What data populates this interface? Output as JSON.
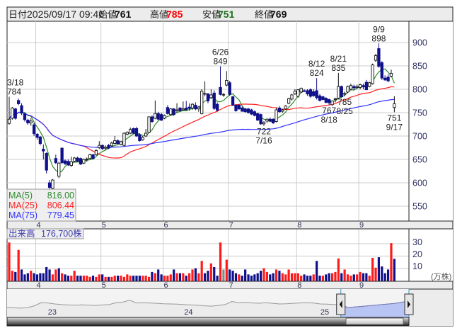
{
  "header": {
    "date_label": "日付",
    "datetime": "2025/09/17 09:46",
    "open_label": "始値",
    "open": "761",
    "high_label": "高値",
    "high": "785",
    "low_label": "安値",
    "low": "751",
    "close_label": "終値",
    "close": "769",
    "colors": {
      "high": "#ff0000",
      "low": "#1e6e1e",
      "open": "#111111",
      "close": "#111111"
    }
  },
  "legend": {
    "ma5_label": "MA(5)",
    "ma5_value": "816.00",
    "ma25_label": "MA(25)",
    "ma25_value": "806.44",
    "ma75_label": "MA(75)",
    "ma75_value": "779.45"
  },
  "volume_legend": {
    "label": "出来高",
    "value": "176,700株"
  },
  "volume_axis": {
    "ticks": [
      "30",
      "20",
      "10"
    ],
    "unit": "(万株)"
  },
  "colors": {
    "up_candle": "#ffffff",
    "down_candle": "#10108a",
    "ma5": "#2e8b2e",
    "ma25": "#ff2020",
    "ma75": "#3030ff",
    "vol_up": "#ff1a1a",
    "vol_down": "#10108a",
    "vol_flat": "#888888",
    "navigator_selected": "#b8c4f4"
  },
  "chart_data": {
    "type": "candlestick",
    "price_axis": {
      "ticks": [
        900,
        850,
        800,
        750,
        700,
        650,
        600,
        550
      ],
      "range": [
        525,
        935
      ]
    },
    "volume_range": [
      0,
      31
    ],
    "grid": true,
    "months": [
      {
        "label": "4",
        "start_index": 9
      },
      {
        "label": "5",
        "start_index": 30
      },
      {
        "label": "6",
        "start_index": 50
      },
      {
        "label": "7",
        "start_index": 71
      },
      {
        "label": "8",
        "start_index": 93
      },
      {
        "label": "9",
        "start_index": 113
      }
    ],
    "ohlc": [
      [
        727,
        784,
        724,
        736
      ],
      [
        738,
        762,
        735,
        760
      ],
      [
        758,
        760,
        735,
        738
      ],
      [
        776,
        780,
        766,
        769
      ],
      [
        765,
        770,
        745,
        749
      ],
      [
        747,
        750,
        731,
        735
      ],
      [
        734,
        737,
        724,
        728
      ],
      [
        728,
        738,
        722,
        732
      ],
      [
        724,
        728,
        700,
        705
      ],
      [
        704,
        706,
        692,
        697
      ],
      [
        698,
        700,
        680,
        684
      ],
      [
        672,
        682,
        650,
        668
      ],
      [
        663,
        665,
        620,
        627
      ],
      [
        600,
        606,
        582,
        590
      ],
      [
        588,
        608,
        585,
        606
      ],
      [
        652,
        660,
        640,
        643
      ],
      [
        614,
        645,
        610,
        642
      ],
      [
        674,
        676,
        640,
        643
      ],
      [
        647,
        650,
        638,
        641
      ],
      [
        646,
        650,
        636,
        638
      ],
      [
        637,
        656,
        634,
        645
      ],
      [
        646,
        655,
        644,
        653
      ],
      [
        653,
        656,
        644,
        646
      ],
      [
        652,
        654,
        638,
        640
      ],
      [
        642,
        652,
        640,
        650
      ],
      [
        650,
        654,
        645,
        651
      ],
      [
        652,
        662,
        650,
        660
      ],
      [
        660,
        662,
        650,
        652
      ],
      [
        660,
        672,
        658,
        669
      ],
      [
        675,
        689,
        672,
        680
      ],
      [
        680,
        682,
        670,
        673
      ],
      [
        674,
        680,
        670,
        676
      ],
      [
        680,
        683,
        672,
        674
      ],
      [
        679,
        688,
        676,
        685
      ],
      [
        684,
        700,
        682,
        690
      ],
      [
        690,
        693,
        682,
        684
      ],
      [
        682,
        690,
        680,
        688
      ],
      [
        680,
        708,
        678,
        706
      ],
      [
        704,
        710,
        702,
        708
      ],
      [
        706,
        718,
        704,
        714
      ],
      [
        716,
        718,
        704,
        706
      ],
      [
        716,
        720,
        698,
        700
      ],
      [
        703,
        706,
        688,
        690
      ],
      [
        692,
        700,
        690,
        697
      ],
      [
        700,
        715,
        698,
        706
      ],
      [
        708,
        742,
        706,
        741
      ],
      [
        741,
        744,
        728,
        731
      ],
      [
        738,
        776,
        736,
        748
      ],
      [
        748,
        752,
        734,
        736
      ],
      [
        746,
        750,
        732,
        734
      ],
      [
        738,
        746,
        736,
        744
      ],
      [
        761,
        766,
        746,
        748
      ],
      [
        746,
        760,
        744,
        758
      ],
      [
        758,
        760,
        743,
        746
      ],
      [
        754,
        770,
        750,
        756
      ],
      [
        760,
        762,
        752,
        754
      ],
      [
        756,
        774,
        754,
        758
      ],
      [
        760,
        775,
        755,
        756
      ],
      [
        762,
        770,
        754,
        759
      ],
      [
        760,
        770,
        756,
        768
      ],
      [
        766,
        772,
        755,
        758
      ],
      [
        758,
        764,
        752,
        762
      ],
      [
        748,
        800,
        746,
        796
      ],
      [
        790,
        817,
        785,
        791
      ],
      [
        790,
        792,
        770,
        775
      ],
      [
        782,
        800,
        780,
        788
      ],
      [
        792,
        798,
        756,
        759
      ],
      [
        768,
        772,
        752,
        755
      ],
      [
        804,
        849,
        787,
        789
      ],
      [
        788,
        792,
        784,
        789
      ],
      [
        809,
        839,
        806,
        819
      ],
      [
        814,
        818,
        786,
        789
      ],
      [
        784,
        786,
        764,
        766
      ],
      [
        766,
        768,
        752,
        754
      ],
      [
        766,
        768,
        756,
        758
      ],
      [
        760,
        763,
        752,
        753
      ],
      [
        758,
        760,
        750,
        752
      ],
      [
        758,
        760,
        748,
        750
      ],
      [
        756,
        758,
        745,
        747
      ],
      [
        752,
        755,
        742,
        744
      ],
      [
        748,
        750,
        732,
        734
      ],
      [
        746,
        748,
        724,
        726
      ],
      [
        726,
        732,
        722,
        729
      ],
      [
        732,
        738,
        728,
        736
      ],
      [
        736,
        740,
        730,
        732
      ],
      [
        736,
        738,
        726,
        728
      ],
      [
        731,
        760,
        729,
        756
      ],
      [
        760,
        764,
        750,
        752
      ],
      [
        753,
        758,
        750,
        756
      ],
      [
        758,
        766,
        756,
        764
      ],
      [
        770,
        782,
        768,
        780
      ],
      [
        779,
        790,
        776,
        788
      ],
      [
        790,
        800,
        788,
        796
      ],
      [
        785,
        800,
        782,
        799
      ],
      [
        794,
        804,
        792,
        802
      ],
      [
        797,
        800,
        794,
        796
      ],
      [
        797,
        800,
        786,
        790
      ],
      [
        799,
        802,
        782,
        785
      ],
      [
        795,
        800,
        784,
        786
      ],
      [
        797,
        824,
        778,
        782
      ],
      [
        786,
        790,
        774,
        776
      ],
      [
        784,
        786,
        776,
        778
      ],
      [
        781,
        783,
        770,
        772
      ],
      [
        778,
        780,
        767,
        771
      ],
      [
        767,
        776,
        765,
        775
      ],
      [
        778,
        782,
        772,
        780
      ],
      [
        781,
        835,
        779,
        806
      ],
      [
        806,
        808,
        782,
        784
      ],
      [
        790,
        795,
        785,
        791
      ],
      [
        794,
        808,
        792,
        806
      ],
      [
        800,
        812,
        798,
        808
      ],
      [
        806,
        810,
        798,
        803
      ],
      [
        804,
        810,
        800,
        806
      ],
      [
        804,
        812,
        800,
        810
      ],
      [
        808,
        812,
        800,
        805
      ],
      [
        815,
        820,
        799,
        799
      ],
      [
        806,
        816,
        804,
        814
      ],
      [
        812,
        855,
        810,
        852
      ],
      [
        862,
        876,
        858,
        872
      ],
      [
        887,
        898,
        846,
        849
      ],
      [
        857,
        860,
        820,
        824
      ],
      [
        824,
        830,
        818,
        820
      ],
      [
        826,
        832,
        815,
        818
      ],
      [
        828,
        842,
        826,
        834
      ],
      [
        761,
        785,
        751,
        769
      ]
    ],
    "volume": [
      33,
      8,
      7,
      25,
      9,
      5,
      6,
      8,
      6,
      5,
      6,
      6,
      11,
      9,
      5,
      9,
      10,
      6,
      5,
      4,
      4,
      8,
      4,
      4,
      4,
      4,
      3,
      4,
      3,
      5,
      5,
      3,
      3,
      3,
      4,
      4,
      4,
      3,
      5,
      4,
      4,
      4,
      4,
      4,
      4,
      3,
      7,
      6,
      9,
      5,
      4,
      4,
      5,
      9,
      6,
      6,
      6,
      4,
      6,
      9,
      10,
      6,
      16,
      6,
      8,
      14,
      11,
      4,
      31,
      9,
      17,
      9,
      8,
      6,
      5,
      4,
      9,
      5,
      4,
      5,
      6,
      8,
      10,
      7,
      5,
      6,
      9,
      8,
      6,
      5,
      9,
      6,
      6,
      6,
      4,
      5,
      4,
      4,
      5,
      16,
      4,
      4,
      5,
      6,
      6,
      7,
      18,
      6,
      9,
      5,
      4,
      5,
      5,
      7,
      6,
      6,
      4,
      18.5,
      10.5,
      19,
      11.5,
      6,
      9,
      30.5,
      17.7
    ],
    "moving_averages": [
      5,
      25,
      75
    ],
    "annotations": [
      {
        "date": "3/18",
        "value": "784",
        "index": 0,
        "kind": "high",
        "align": "start"
      },
      {
        "date": "6/26",
        "value": "849",
        "index": 68,
        "kind": "high",
        "align": "middle"
      },
      {
        "date": "7/16",
        "value": "722",
        "index": 82,
        "kind": "low",
        "align": "middle"
      },
      {
        "date": "8/12",
        "value": "824",
        "index": 99,
        "kind": "high",
        "align": "middle"
      },
      {
        "date": "8/18",
        "value": "767",
        "index": 103,
        "kind": "low",
        "align": "middle"
      },
      {
        "date": "8/21",
        "value": "835",
        "index": 106,
        "kind": "high",
        "align": "middle"
      },
      {
        "date": "8/25",
        "value": "785",
        "index": 108,
        "kind": "low",
        "align": "middle"
      },
      {
        "date": "9/9",
        "value": "898",
        "index": 119,
        "kind": "high",
        "align": "middle"
      },
      {
        "date": "9/17",
        "value": "751",
        "index": 124,
        "kind": "low",
        "align": "middle"
      }
    ]
  },
  "navigator": {
    "series": [
      560,
      558,
      556,
      560,
      575,
      600,
      598,
      590,
      585,
      582,
      580,
      583,
      580,
      578,
      582,
      585,
      600,
      605,
      620,
      598,
      600,
      597,
      595,
      592,
      590,
      588,
      585,
      582,
      580,
      575,
      572,
      578,
      585,
      610,
      600,
      603,
      598,
      596,
      600,
      595,
      590,
      592,
      595,
      598,
      600,
      597,
      590,
      588,
      585,
      590,
      560,
      565,
      570,
      575,
      580,
      585,
      590,
      595,
      605,
      610
    ],
    "year_marks": [
      {
        "label": "23",
        "index": 6
      },
      {
        "label": "24",
        "index": 26
      },
      {
        "label": "25",
        "index": 46
      }
    ],
    "selected_range": [
      49,
      59
    ]
  }
}
